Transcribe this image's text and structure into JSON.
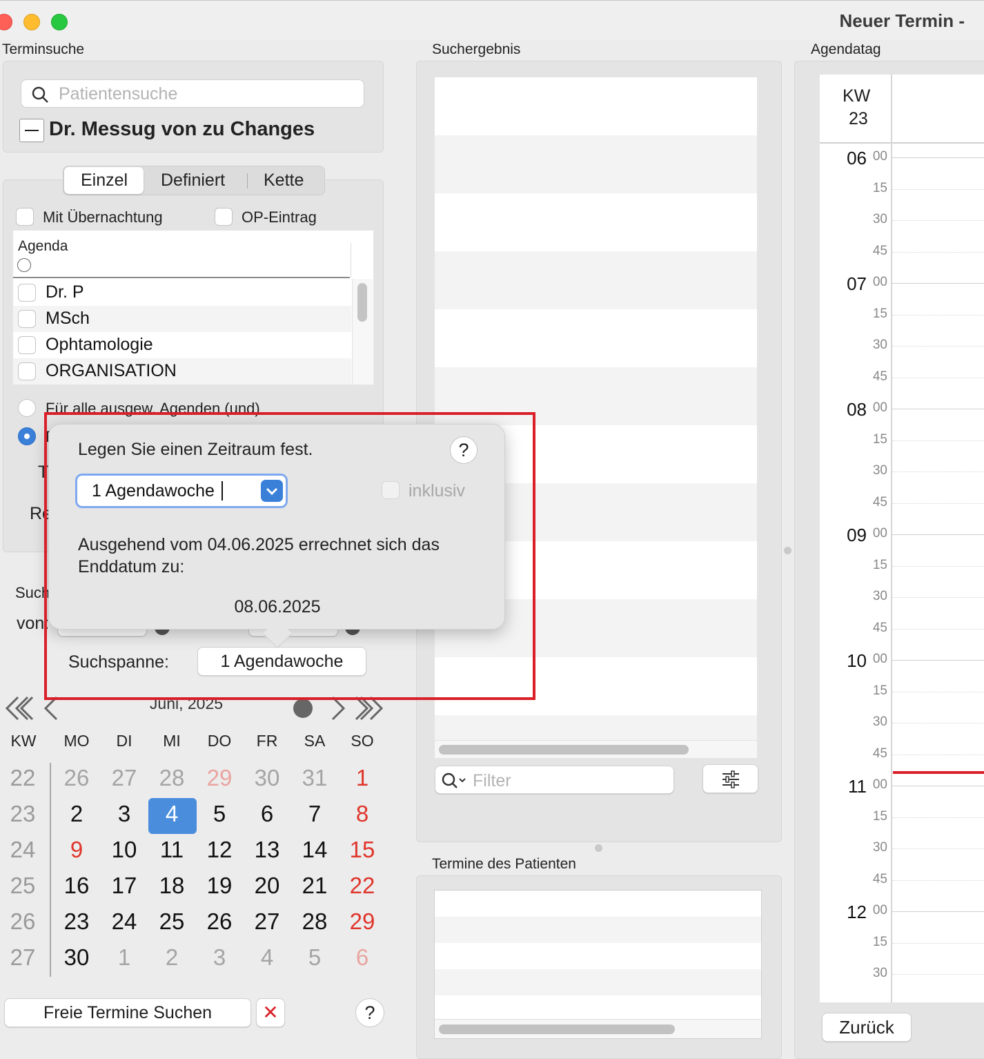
{
  "window": {
    "title": "Neuer Termin  -"
  },
  "sections": {
    "terminsuche": "Terminsuche",
    "suchergebnis": "Suchergebnis",
    "agendatag": "Agendatag",
    "termine_patient": "Termine des Patienten"
  },
  "search": {
    "placeholder": "Patientensuche"
  },
  "patient": {
    "name": "Dr. Messug von zu Changes",
    "toggle": "—"
  },
  "tabs": [
    "Einzel",
    "Definiert",
    "Kette"
  ],
  "options": {
    "overnight": "Mit Übernachtung",
    "op": "OP-Eintrag"
  },
  "agenda_list": {
    "header": "Agenda",
    "items": [
      "Dr. P",
      "MSch",
      "Ophtamologie",
      "ORGANISATION"
    ]
  },
  "radio": {
    "all": "Für alle ausgew. Agenden (und)",
    "partial_a": "F",
    "partial_t": "T",
    "partial_re": "Re",
    "partial_such": "Such",
    "partial_von": "von:"
  },
  "popover": {
    "title": "Legen Sie einen Zeitraum fest.",
    "help": "?",
    "select_value": "1 Agendawoche",
    "inklusiv": "inklusiv",
    "text": "Ausgehend vom 04.06.2025 errechnet sich das Enddatum zu:",
    "end_date": "08.06.2025"
  },
  "suchspanne": {
    "label": "Suchspanne:",
    "value": "1 Agendawoche"
  },
  "calendar": {
    "month": "Juni, 2025",
    "headers": [
      "KW",
      "MO",
      "DI",
      "MI",
      "DO",
      "FR",
      "SA",
      "SO"
    ],
    "weeks": [
      {
        "kw": "22",
        "days": [
          "26",
          "27",
          "28",
          "29",
          "30",
          "31",
          "1"
        ]
      },
      {
        "kw": "23",
        "days": [
          "2",
          "3",
          "4",
          "5",
          "6",
          "7",
          "8"
        ]
      },
      {
        "kw": "24",
        "days": [
          "9",
          "10",
          "11",
          "12",
          "13",
          "14",
          "15"
        ]
      },
      {
        "kw": "25",
        "days": [
          "16",
          "17",
          "18",
          "19",
          "20",
          "21",
          "22"
        ]
      },
      {
        "kw": "26",
        "days": [
          "23",
          "24",
          "25",
          "26",
          "27",
          "28",
          "29"
        ]
      },
      {
        "kw": "27",
        "days": [
          "30",
          "1",
          "2",
          "3",
          "4",
          "5",
          "6"
        ]
      }
    ]
  },
  "buttons": {
    "search_free": "Freie Termine Suchen",
    "cancel": "✕",
    "help": "?",
    "back": "Zurück"
  },
  "filter": {
    "placeholder": "Filter"
  },
  "agendatag": {
    "kw_label": "KW",
    "kw_num": "23",
    "hours": [
      "06",
      "07",
      "08",
      "09",
      "10",
      "11",
      "12"
    ],
    "minutes": [
      "00",
      "15",
      "30",
      "45"
    ]
  },
  "colors": {
    "accent": "#3a80d9",
    "weekend": "#e0352b",
    "highlight_box": "#d92028"
  }
}
